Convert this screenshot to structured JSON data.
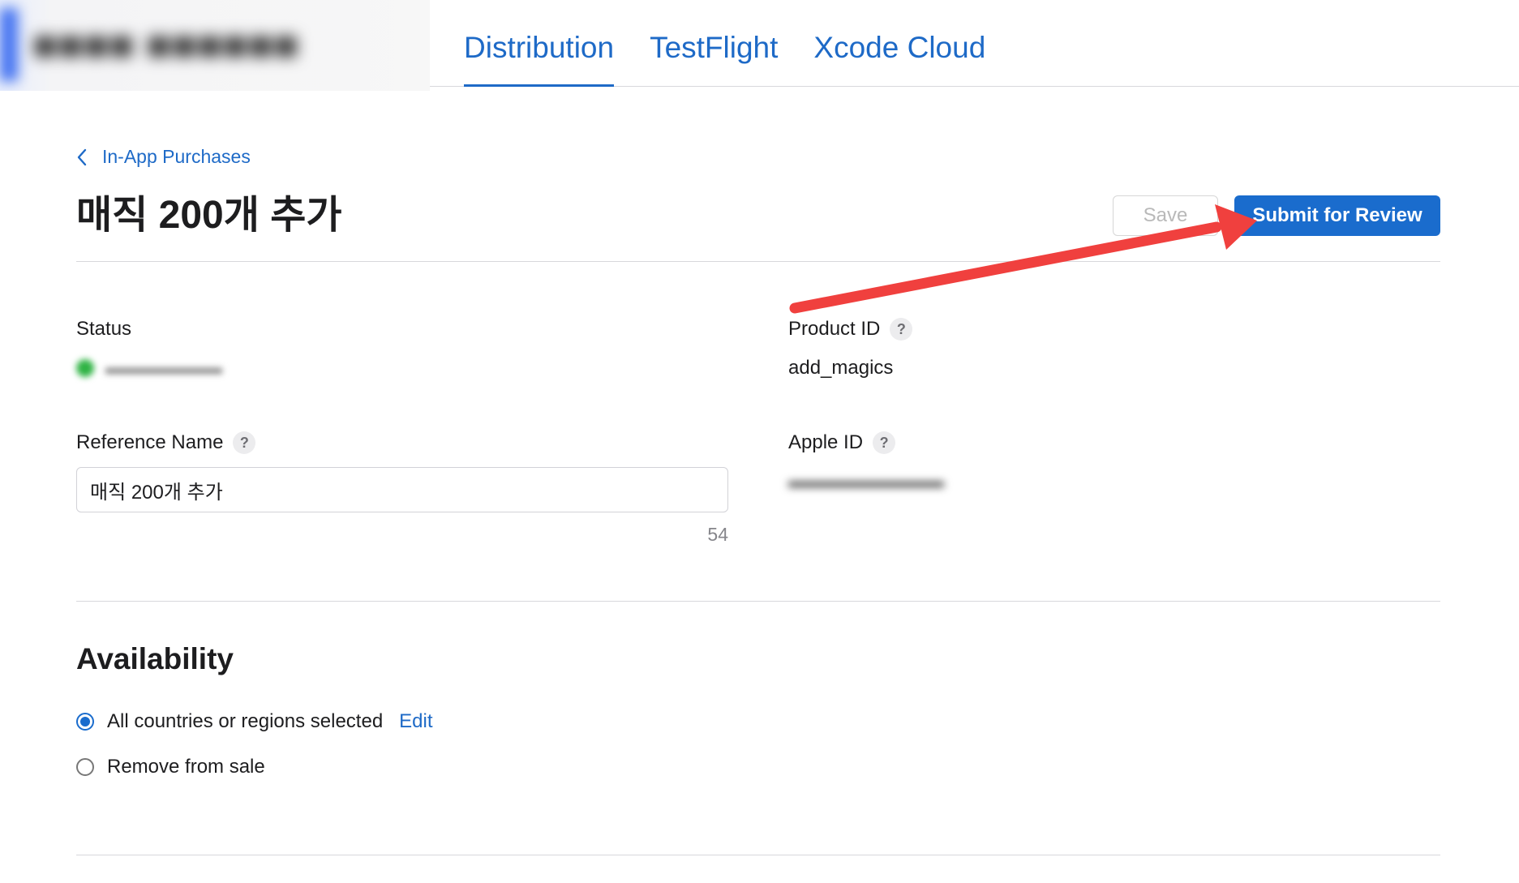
{
  "topbar": {
    "tabs": [
      {
        "label": "Distribution",
        "active": true
      },
      {
        "label": "TestFlight",
        "active": false
      },
      {
        "label": "Xcode Cloud",
        "active": false
      }
    ]
  },
  "breadcrumb": {
    "label": "In-App Purchases"
  },
  "page": {
    "title": "매직 200개 추가"
  },
  "actions": {
    "save_label": "Save",
    "submit_label": "Submit for Review"
  },
  "fields": {
    "status_label": "Status",
    "product_id_label": "Product ID",
    "product_id_value": "add_magics",
    "reference_name_label": "Reference Name",
    "reference_name_value": "매직 200개 추가",
    "reference_name_remaining": "54",
    "apple_id_label": "Apple ID",
    "help_glyph": "?"
  },
  "availability": {
    "title": "Availability",
    "option_all": "All countries or regions selected",
    "edit_label": "Edit",
    "option_remove": "Remove from sale",
    "selected": "all"
  },
  "colors": {
    "accent": "#1e6ac7",
    "primary_button": "#1a6ccd",
    "annotation_arrow": "#f0403e"
  },
  "icons": {
    "back": "chevron-left-icon",
    "help": "help-icon",
    "annotation": "red-arrow-icon"
  }
}
